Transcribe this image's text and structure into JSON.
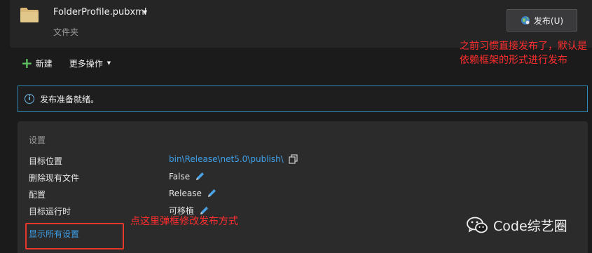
{
  "header": {
    "profile_name": "FolderProfile.pubxml",
    "profile_type": "文件夹",
    "publish_label": "发布(U)"
  },
  "toolbar": {
    "new_label": "新建",
    "more_label": "更多操作"
  },
  "info": {
    "message": "发布准备就绪。"
  },
  "settings": {
    "title": "设置",
    "rows": [
      {
        "label": "目标位置",
        "value": "bin\\Release\\net5.0\\publish\\"
      },
      {
        "label": "删除现有文件",
        "value": "False"
      },
      {
        "label": "配置",
        "value": "Release"
      },
      {
        "label": "目标运行时",
        "value": "可移植"
      }
    ],
    "show_all_label": "显示所有设置"
  },
  "annotations": {
    "top_note": "之前习惯直接发布了，默认是依赖框架的形式进行发布",
    "bottom_note": "点这里弹框修改发布方式",
    "highlight_color": "#e5382a"
  },
  "watermark": {
    "text": "Code综艺圈"
  },
  "colors": {
    "accent_link": "#3ea0e8",
    "info_border": "#2e8ab8",
    "new_icon": "#5fc15f",
    "annotation_text": "#ff2d2d"
  }
}
